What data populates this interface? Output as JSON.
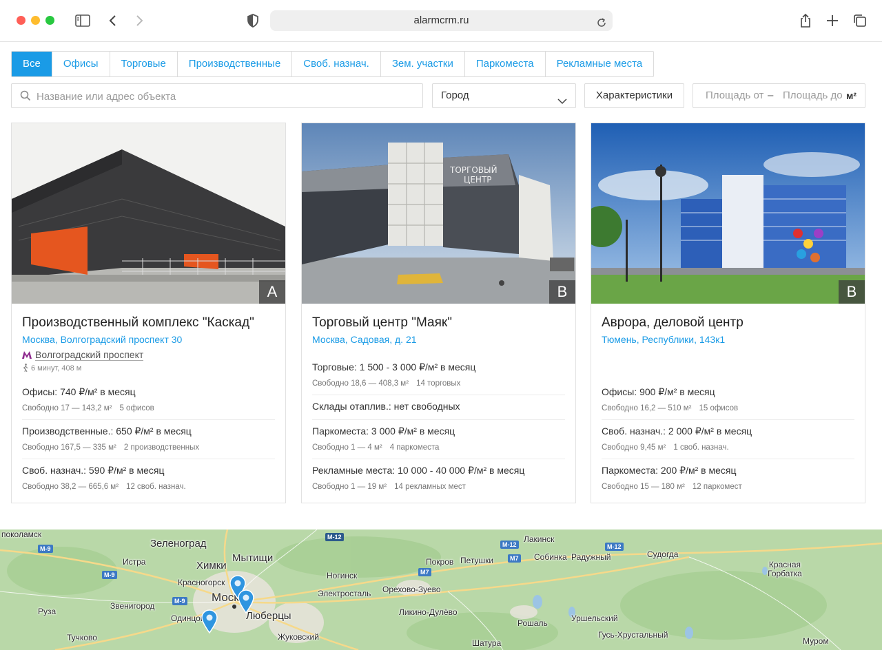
{
  "browser": {
    "url": "alarmcrm.ru"
  },
  "tabs": [
    {
      "label": "Все",
      "active": true
    },
    {
      "label": "Офисы",
      "active": false
    },
    {
      "label": "Торговые",
      "active": false
    },
    {
      "label": "Производственные",
      "active": false
    },
    {
      "label": "Своб. назнач.",
      "active": false
    },
    {
      "label": "Зем. участки",
      "active": false
    },
    {
      "label": "Паркоместа",
      "active": false
    },
    {
      "label": "Рекламные места",
      "active": false
    }
  ],
  "filters": {
    "search_placeholder": "Название или адрес объекта",
    "city_label": "Город",
    "characteristics_label": "Характеристики",
    "area_from_placeholder": "Площадь от",
    "area_dash": "–",
    "area_to_placeholder": "Площадь до",
    "area_unit": "м²"
  },
  "cards": [
    {
      "class": "A",
      "title": "Производственный комплекс \"Каскад\"",
      "address": "Москва, Волгоградский проспект 30",
      "metro": "Волгоградский проспект",
      "walk": "6 минут, 408 м",
      "offers": [
        {
          "main": "Офисы: 740 ₽/м² в месяц",
          "free": "Свободно 17 — 143,2 м²",
          "count": "5 офисов"
        },
        {
          "main": "Производственные.: 650 ₽/м² в месяц",
          "free": "Свободно 167,5 — 335 м²",
          "count": "2 производственных"
        },
        {
          "main": "Своб. назнач.: 590 ₽/м² в месяц",
          "free": "Свободно 38,2 — 665,6 м²",
          "count": "12 своб. назнач."
        }
      ]
    },
    {
      "class": "B",
      "title": "Торговый центр \"Маяк\"",
      "address": "Москва, Садовая, д. 21",
      "offers": [
        {
          "main": "Торговые: 1 500 - 3 000 ₽/м² в месяц",
          "free": "Свободно 18,6 — 408,3 м²",
          "count": "14 торговых"
        },
        {
          "main": "Склады отаплив.: нет свободных",
          "free": "",
          "count": ""
        },
        {
          "main": "Паркоместа: 3 000 ₽/м² в месяц",
          "free": "Свободно 1 — 4 м²",
          "count": "4 паркоместа"
        },
        {
          "main": "Рекламные места: 10 000 - 40 000 ₽/м² в месяц",
          "free": "Свободно 1 — 19 м²",
          "count": "14 рекламных мест"
        }
      ]
    },
    {
      "class": "B",
      "title": "Аврора, деловой центр",
      "address": "Тюмень, Республики, 143к1",
      "offers": [
        {
          "main": "Офисы: 900 ₽/м² в месяц",
          "free": "Свободно 16,2 — 510 м²",
          "count": "15 офисов"
        },
        {
          "main": "Своб. назнач.: 2 000 ₽/м² в месяц",
          "free": "Свободно 9,45 м²",
          "count": "1 своб. назнач."
        },
        {
          "main": "Паркоместа: 200 ₽/м² в месяц",
          "free": "Свободно 15 — 180 м²",
          "count": "12 паркомест"
        }
      ]
    }
  ],
  "map": {
    "cities": [
      "поколамск",
      "Зеленоград",
      "Мытищи",
      "Истра",
      "Химки",
      "Красногорск",
      "Москва",
      "Звенигород",
      "Люберцы",
      "Руза",
      "Одинцово",
      "Тучково",
      "Жуковский",
      "Ногинск",
      "Электросталь",
      "Орехово-Зуево",
      "Покров",
      "Петушки",
      "Ликино-Дулёво",
      "Рошаль",
      "Шатура",
      "Уршельский",
      "Гусь-Хрустальный",
      "Лакинск",
      "Собинка",
      "Радужный",
      "Судогда",
      "Красная Горбатка",
      "Муром"
    ],
    "roads": [
      "M-9",
      "M-9",
      "M-9",
      "M-12",
      "M-12",
      "M-12",
      "M7",
      "M7"
    ],
    "colors": {
      "accent": "#1a9be6",
      "land": "#b9d8a8",
      "water": "#9cc4e4"
    }
  }
}
